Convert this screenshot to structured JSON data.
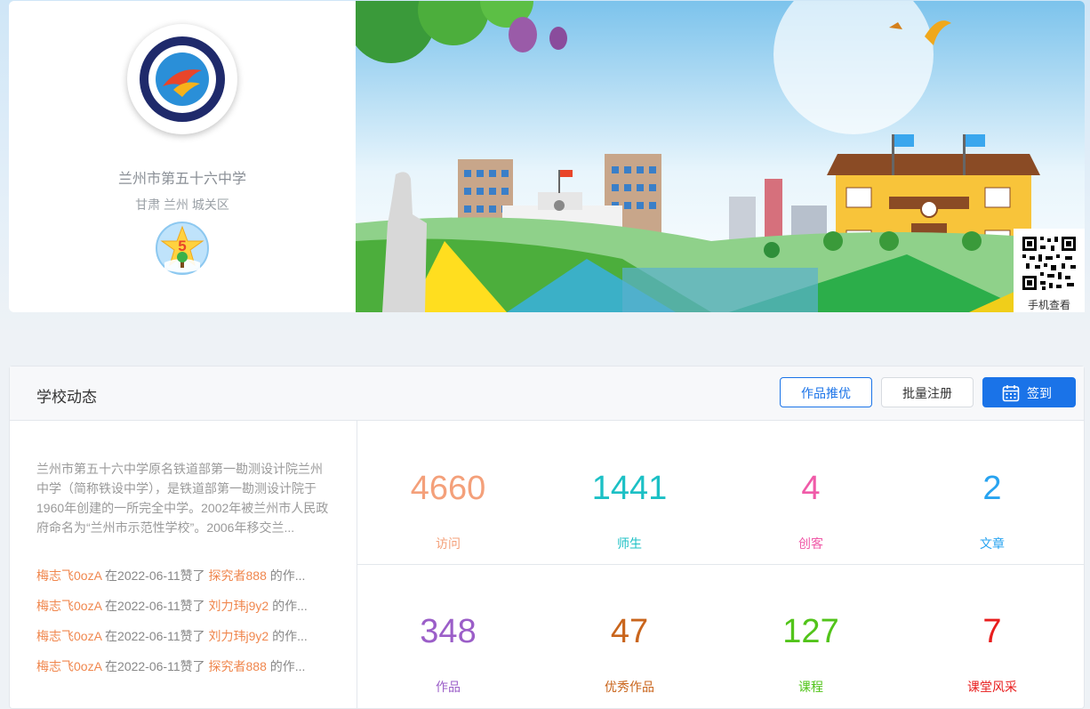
{
  "profile": {
    "school_name": "兰州市第五十六中学",
    "region": "甘肃 兰州 城关区",
    "level": "5"
  },
  "banner": {
    "qr_label": "手机查看"
  },
  "panel": {
    "title": "学校动态",
    "buttons": {
      "recommend": "作品推优",
      "batch_register": "批量注册",
      "sign_in": "签到"
    },
    "intro": "兰州市第五十六中学原名铁道部第一勘测设计院兰州中学（简称铁设中学），是铁道部第一勘测设计院于1960年创建的一所完全中学。2002年被兰州市人民政府命名为“兰州市示范性学校”。2006年移交兰...",
    "activities": [
      {
        "user": "梅志飞0ozA",
        "action": "在2022-06-11赞了",
        "target": "探究者888",
        "suffix": "的作..."
      },
      {
        "user": "梅志飞0ozA",
        "action": "在2022-06-11赞了",
        "target": "刘力玮j9y2",
        "suffix": "的作..."
      },
      {
        "user": "梅志飞0ozA",
        "action": "在2022-06-11赞了",
        "target": "刘力玮j9y2",
        "suffix": "的作..."
      },
      {
        "user": "梅志飞0ozA",
        "action": "在2022-06-11赞了",
        "target": "探究者888",
        "suffix": "的作..."
      }
    ],
    "stats": [
      {
        "value": "4660",
        "label": "访问",
        "color": "#f4a07a"
      },
      {
        "value": "1441",
        "label": "师生",
        "color": "#1cc0c5"
      },
      {
        "value": "4",
        "label": "创客",
        "color": "#f05aa8"
      },
      {
        "value": "2",
        "label": "文章",
        "color": "#27a3f0"
      },
      {
        "value": "348",
        "label": "作品",
        "color": "#9b5ec8"
      },
      {
        "value": "47",
        "label": "优秀作品",
        "color": "#c9651c"
      },
      {
        "value": "127",
        "label": "课程",
        "color": "#52c41a"
      },
      {
        "value": "7",
        "label": "课堂风采",
        "color": "#e81d1d"
      }
    ]
  }
}
